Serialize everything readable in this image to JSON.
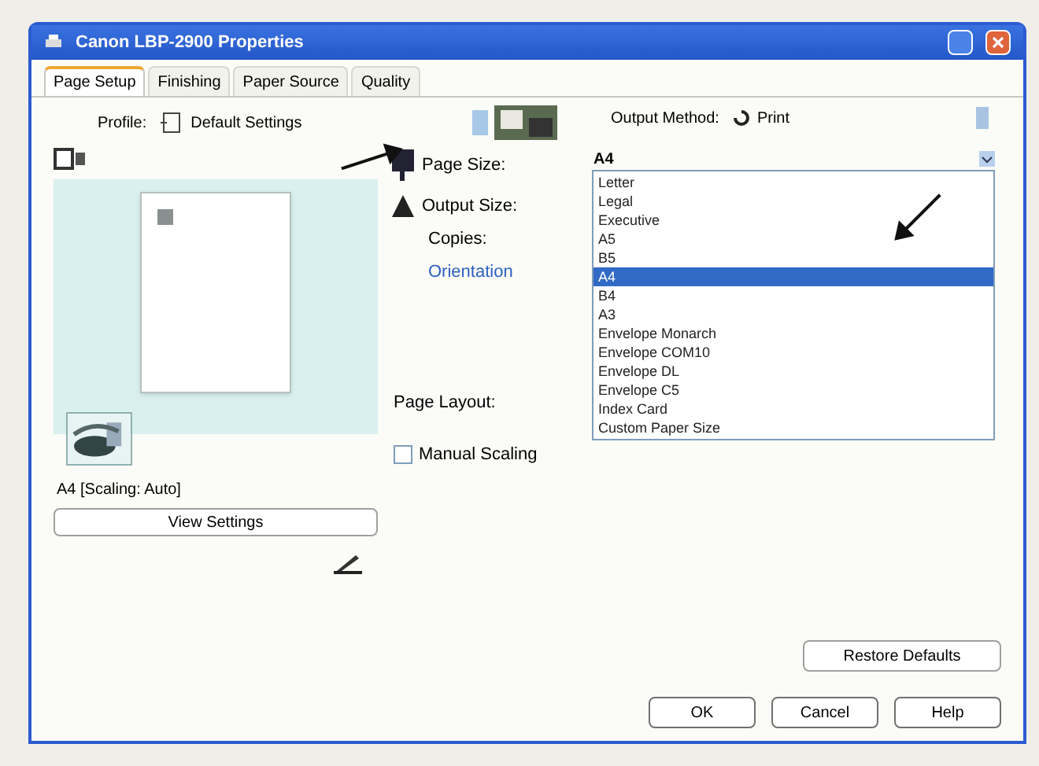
{
  "window": {
    "title": "Canon LBP-2900 Properties"
  },
  "tabs": [
    {
      "label": "Page Setup",
      "selected": true
    },
    {
      "label": "Finishing",
      "selected": false
    },
    {
      "label": "Paper Source",
      "selected": false
    },
    {
      "label": "Quality",
      "selected": false
    }
  ],
  "profile": {
    "label": "Profile:",
    "value": "Default Settings"
  },
  "output_method": {
    "label": "Output Method:",
    "value": "Print"
  },
  "preview": {
    "caption": "A4 [Scaling: Auto]",
    "button": "View Settings"
  },
  "fields": [
    {
      "label": "Page Size:",
      "kind": "label"
    },
    {
      "label": "Output Size:",
      "kind": "label"
    },
    {
      "label": "Copies:",
      "kind": "label"
    },
    {
      "label": "Orientation",
      "kind": "link"
    },
    {
      "label": "Page Layout:",
      "kind": "label"
    },
    {
      "label": "Manual Scaling",
      "kind": "checkbox",
      "checked": false
    }
  ],
  "page_size": {
    "value": "A4",
    "options": [
      {
        "label": "Letter",
        "selected": false
      },
      {
        "label": "Legal",
        "selected": false
      },
      {
        "label": "Executive",
        "selected": false
      },
      {
        "label": "A5",
        "selected": false
      },
      {
        "label": "B5",
        "selected": false
      },
      {
        "label": "A4",
        "selected": true
      },
      {
        "label": "B4",
        "selected": false
      },
      {
        "label": "A3",
        "selected": false
      },
      {
        "label": "Envelope Monarch",
        "selected": false
      },
      {
        "label": "Envelope COM10",
        "selected": false
      },
      {
        "label": "Envelope DL",
        "selected": false
      },
      {
        "label": "Envelope C5",
        "selected": false
      },
      {
        "label": "Index Card",
        "selected": false
      },
      {
        "label": "Custom Paper Size",
        "selected": false
      }
    ]
  },
  "restore_button": "Restore Defaults",
  "dialog_buttons": [
    "OK",
    "Cancel",
    "Help"
  ]
}
